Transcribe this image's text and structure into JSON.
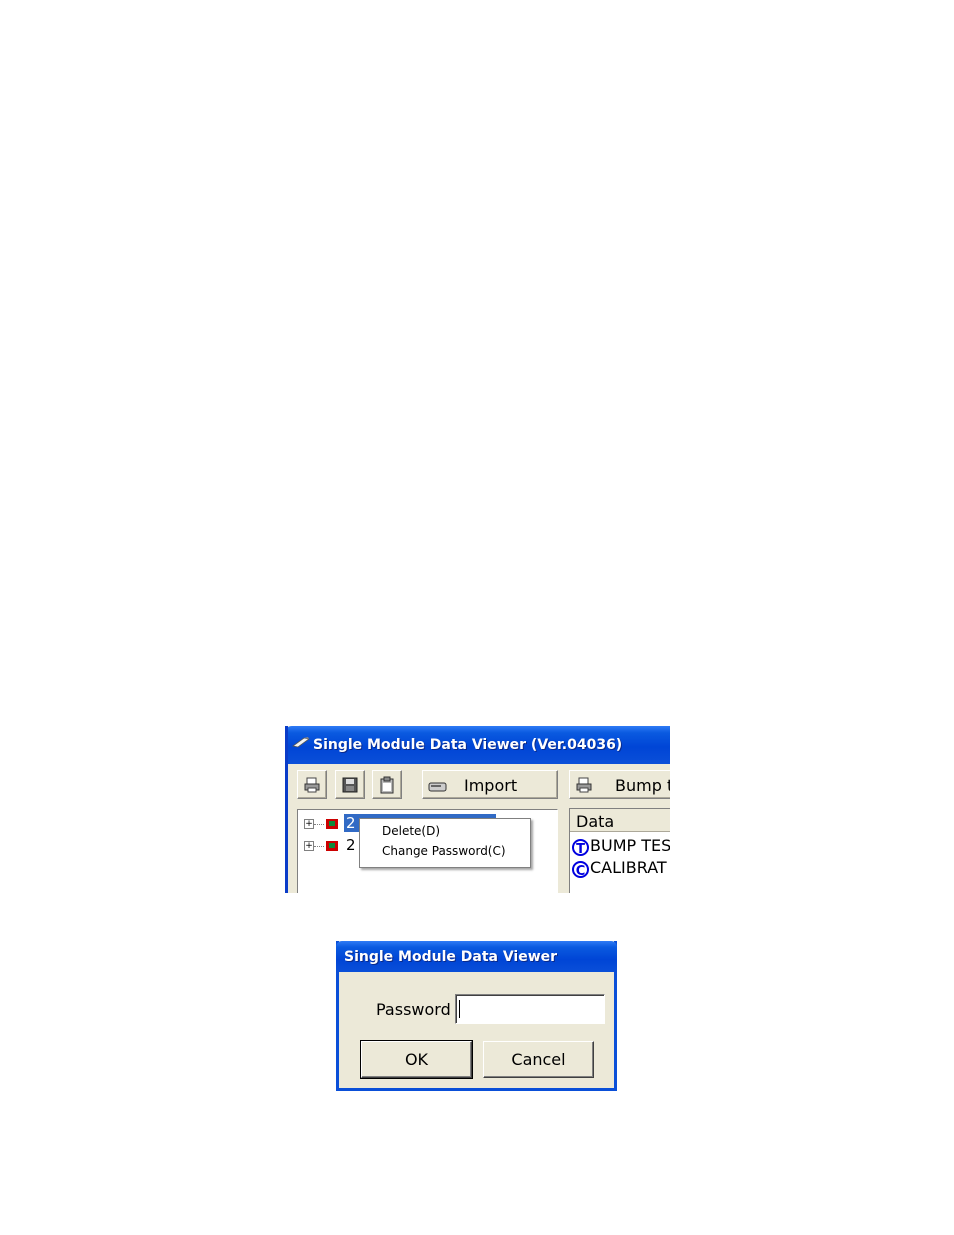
{
  "main_window": {
    "title": "Single Module Data Viewer (Ver.04036)",
    "toolbar": {
      "import_label": "Import",
      "bump_label": "Bump t"
    },
    "tree": {
      "items": [
        {
          "label": "2",
          "selected": true
        },
        {
          "label": "2",
          "selected": false
        }
      ]
    },
    "context_menu": {
      "items": [
        "Delete(D)",
        "Change Password(C)"
      ]
    },
    "data_panel": {
      "header": "Data",
      "rows": [
        {
          "badge": "T",
          "text": "BUMP TES"
        },
        {
          "badge": "C",
          "text": "CALIBRAT"
        }
      ]
    }
  },
  "password_dialog": {
    "title": "Single Module Data Viewer",
    "password_label": "Password",
    "password_value": "",
    "ok_label": "OK",
    "cancel_label": "Cancel"
  },
  "colors": {
    "titlebar": "#0045d6",
    "selection": "#316ac5",
    "window_bg": "#ece9d8",
    "badge": "#0000e0"
  }
}
